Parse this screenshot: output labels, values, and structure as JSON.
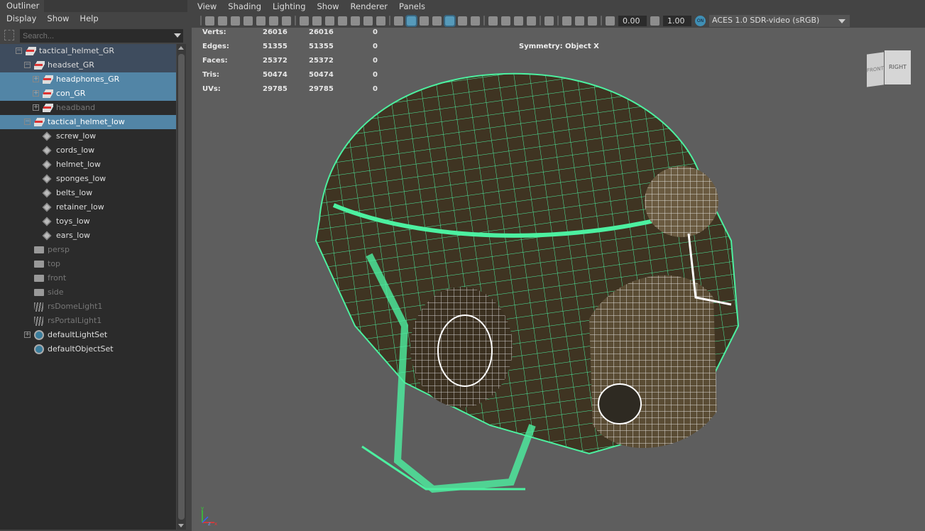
{
  "outliner": {
    "tab": "Outliner",
    "menu": [
      "Display",
      "Show",
      "Help"
    ],
    "search_placeholder": "Search...",
    "items": [
      {
        "label": "tactical_helmet_GR"
      },
      {
        "label": "headset_GR"
      },
      {
        "label": "headphones_GR"
      },
      {
        "label": "con_GR"
      },
      {
        "label": "headband"
      },
      {
        "label": "tactical_helmet_low"
      },
      {
        "label": "screw_low"
      },
      {
        "label": "cords_low"
      },
      {
        "label": "helmet_low"
      },
      {
        "label": "sponges_low"
      },
      {
        "label": "belts_low"
      },
      {
        "label": "retainer_low"
      },
      {
        "label": "toys_low"
      },
      {
        "label": "ears_low"
      },
      {
        "label": "persp"
      },
      {
        "label": "top"
      },
      {
        "label": "front"
      },
      {
        "label": "side"
      },
      {
        "label": "rsDomeLight1"
      },
      {
        "label": "rsPortalLight1"
      },
      {
        "label": "defaultLightSet"
      },
      {
        "label": "defaultObjectSet"
      }
    ]
  },
  "viewport": {
    "menu": [
      "View",
      "Shading",
      "Lighting",
      "Show",
      "Renderer",
      "Panels"
    ],
    "exposure": "0.00",
    "gamma": "1.00",
    "color_mgmt_badge": "ON",
    "color_space": "ACES 1.0 SDR-video (sRGB)",
    "hud": [
      {
        "label": "Verts:",
        "a": "26016",
        "b": "26016",
        "c": "0"
      },
      {
        "label": "Edges:",
        "a": "51355",
        "b": "51355",
        "c": "0"
      },
      {
        "label": "Faces:",
        "a": "25372",
        "b": "25372",
        "c": "0"
      },
      {
        "label": "Tris:",
        "a": "50474",
        "b": "50474",
        "c": "0"
      },
      {
        "label": "UVs:",
        "a": "29785",
        "b": "29785",
        "c": "0"
      }
    ],
    "symmetry": "Symmetry: Object X",
    "viewcube": {
      "front": "FRONT",
      "right": "RIGHT"
    },
    "axis": {
      "x": "x",
      "y": "y",
      "z": "z"
    }
  },
  "colors": {
    "selection": "#5285a6",
    "wire": "#4cf0a0",
    "accent": "#5aa9cf"
  }
}
